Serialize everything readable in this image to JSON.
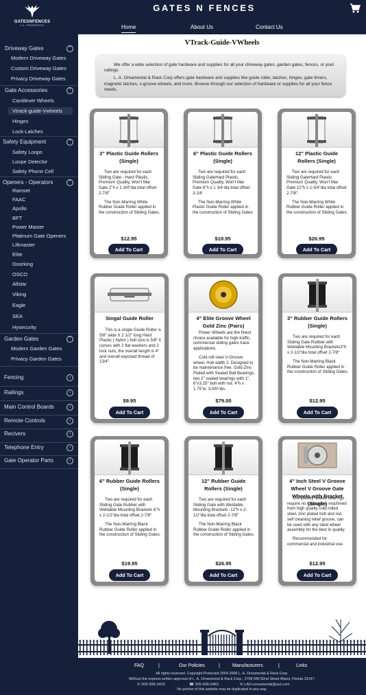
{
  "header": {
    "logo_title": "GATESNFENCES",
    "logo_subtitle": "L.A. ORNAMENTAL",
    "brand": "GATES N FENCES",
    "cart_icon": "cart-icon",
    "nav": [
      "Home",
      "About Us",
      "Contact Us"
    ]
  },
  "sidebar": {
    "sections": [
      {
        "label": "Driveway Gates",
        "items": [
          "Modern Driveway Gates",
          "Custom Driveway Gates",
          "Privacy Driveway Gates"
        ]
      },
      {
        "label": "Gate Accessories",
        "items": [
          "Cantilever Wheels",
          "Vtrack-guide-Vwheels",
          "Hinges",
          "Lock-Latches"
        ]
      },
      {
        "label": "Safety Equipment",
        "items": [
          "Safety Loops",
          "Loope Detector",
          "Safety Phone Cell"
        ]
      },
      {
        "label": "Openers - Operators",
        "items": [
          "Ramset",
          "FAAC",
          "Apollo",
          "BFT",
          "Power Master",
          "Platinum Gate Openers",
          "Liftmaster",
          "Elite",
          "Doorking",
          "OSCO",
          "Allstar",
          "Viking",
          "Eagle",
          "SEA",
          "Hysecurity"
        ]
      },
      {
        "label": "Garden Gates",
        "items": [
          "Modern Garden Gates",
          "Privacy Garden Gates"
        ]
      },
      {
        "label": "Fencing",
        "items": []
      },
      {
        "label": "Railings",
        "items": []
      },
      {
        "label": "Main Control Boards",
        "items": []
      },
      {
        "label": "Remote Controls",
        "items": []
      },
      {
        "label": "Recivers",
        "items": []
      },
      {
        "label": "Telephone Entry",
        "items": []
      },
      {
        "label": "Gate Operator Parts",
        "items": []
      }
    ],
    "selected_item": "Vtrack-guide-Vwheels"
  },
  "main": {
    "title": "VTrack-Guide-VWheels",
    "intro": [
      "We offer a wide selection of gate hardware and supplies for all your driveway gates, garden gates, fences, or pool railings.",
      "L. A. Ornamental & Rack Corp offers gate hardware and supplies like guide roller, latches, hinges, gate timers, magnetic latches, v-groove wheels, and more. Browse through our selection of hardware or supplies for all your fence needs."
    ],
    "add_to_cart_label": "Add To Cart",
    "products": [
      {
        "title": "3\" Plastic Guide Rollers (Single)",
        "desc": [
          "Two are required for each Sliding Gate - Hard Plastic, Premium Quality, Won't Mar Gate 2\"h x 1-3/4\"dia total offset 2-7/8\"",
          "The Non-Marring White Rubber Guide Roller applied in the construction of Sliding Gates."
        ],
        "price": "$12.95",
        "icon": "white-roller-icon"
      },
      {
        "title": "6\" Plastic Guide Rollers (Single)",
        "desc": [
          "Two are required for each Sliding GateHard Plastic, Premium Quality, Won't Mar Gate 6\"h x 1 3/4 dia total offset 3-1/8",
          "The Non-Marring White Plastic Guide Roller applied in the construction of Sliding Gates"
        ],
        "price": "$19.95",
        "icon": "white-roller-icon"
      },
      {
        "title": "12\" Plastic Guide Rollers (Single)",
        "desc": [
          "Two are required for each Sliding GateHard Plastic, Premium Quality, Won't Mar Gate 12\"h x 1-3/4\"dia total offset 2-7/8\".",
          "The Non-Marring White Rubber Guide Roller applied in the construction of Sliding Gates."
        ],
        "price": "$26.95",
        "icon": "white-roller-icon"
      },
      {
        "title": "Singal Guide Roller",
        "desc": [
          "This is a single Guide Roller is 5/8\" wide X 2 1/2\" long Hard Plastic ( Nylon ) bolt size is 5/8\" it comes with 2 flat washers and 2 lock nuts, the overall length is 4\" and overall exposed thread of 13/4\""
        ],
        "price": "$9.95",
        "icon": "single-roller-icon"
      },
      {
        "title": "4\" Elite Groove Wheel Gold Zinc (Pairs)",
        "desc": [
          "Power Wheels are the finest choice available for high-traffic, commercial sliding gates track applications.",
          "Cold roll steel V-Groove wheel. Hub width 2. Designed to be maintenance free. Gold Zinc Plated with Sealed Ball Bearings. two 2\" sealed bearings with 1\", 6\"x3.25\" bolt with nut. 4\"h x 1.75\"w. 3,000 lbs."
        ],
        "price": "$79.00",
        "icon": "gold-wheel-icon"
      },
      {
        "title": "3\" Rubber Guide Rollers (Single)",
        "desc": [
          "Two are required for each Sliding Gate Rubber with Weldable Mounting Brackets3\"h x 2-1/2\"dia total offset 2-7/8\"",
          "The Non-Marring Black Rubber Guide Roller applied in the construction of Sliding Gates."
        ],
        "price": "$12.95",
        "icon": "black-roller-icon"
      },
      {
        "title": "6\" Rubber Guide Rollers (Single)",
        "desc": [
          "Two are required for each Sliding Gate Rubber with Weldable Mounting Brackets 6\"h x 2-1/2\"dia total offset 2-7/8\"",
          "The Non-Marring Black Rubber Guide Roller applied in the construction of Sliding Gates."
        ],
        "price": "$19.95",
        "icon": "black-roller-icon"
      },
      {
        "title": "12\" Rubber Guide Rollers (Single)",
        "desc": [
          "Two are required for each Sliding Gate with Weldable Mounting Brackets -12\"h x 2-1/2\"dia total offset 2-7/8\"",
          "The Non-Marring Black Rubber Guide Roller applied in the construction of Sliding Gates."
        ],
        "price": "$26.95",
        "icon": "black-roller-icon"
      },
      {
        "title": "4\" Inch Steel V Groove Wheel V Groove Gate Wheels with Bracket (Single)",
        "desc": [
          "Completely sealed bearings require no lubrication, machined from high quality cold rolled steel, zinc plated bolt and nut, self cleaning relief groove, can be used with any steel wheel assembly for the best in quality.",
          "Recommended for commercial and industrial use."
        ],
        "price": "$12.95",
        "icon": "steel-wheel-icon"
      }
    ]
  },
  "footer": {
    "links": [
      "FAQ",
      "Our Policies",
      "Manufacturers",
      "Links"
    ],
    "separator": "|",
    "copyright": "All rights reserved. Copyright Protected 2004-2006 L. A. Ornamental & Rack Corp.",
    "address": "Without the express written approval of L. A. Ornamental & Rack Corp., 3708 NW 82nd Street Miami, Florida 33147.",
    "phone1": "305-696-0419",
    "phone2": "305-696-0461",
    "email": "LAO-ornamental@aol.com",
    "notice": "No portion of this website may be duplicated in any way."
  }
}
